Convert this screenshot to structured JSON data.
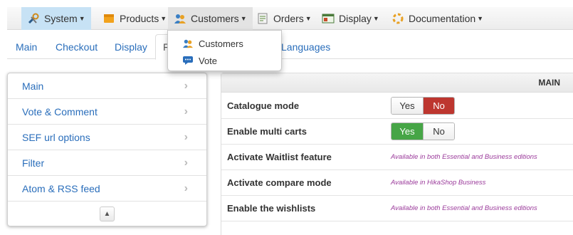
{
  "menu": {
    "system": "System",
    "products": "Products",
    "customers": "Customers",
    "orders": "Orders",
    "display": "Display",
    "documentation": "Documentation"
  },
  "tabs": [
    "Main",
    "Checkout",
    "Display",
    "F",
    "Languages"
  ],
  "dropdown": {
    "items": [
      "Customers",
      "Vote"
    ]
  },
  "sidebar": {
    "items": [
      "Main",
      "Vote & Comment",
      "SEF url options",
      "Filter",
      "Atom & RSS feed"
    ]
  },
  "panel": {
    "header": "MAIN",
    "rows": [
      {
        "label": "Catalogue mode",
        "yes": "Yes",
        "no": "No",
        "selected": "no"
      },
      {
        "label": "Enable multi carts",
        "yes": "Yes",
        "no": "No",
        "selected": "yes"
      },
      {
        "label": "Activate Waitlist feature",
        "note": "Available in both Essential and Business editions"
      },
      {
        "label": "Activate compare mode",
        "note": "Available in HikaShop Business"
      },
      {
        "label": "Enable the wishlists",
        "note": "Available in both Essential and Business editions"
      }
    ]
  },
  "colors": {
    "link": "#2a6ebb",
    "no_active": "#bd362f",
    "yes_active": "#46a546",
    "note": "#9b3b9b"
  }
}
